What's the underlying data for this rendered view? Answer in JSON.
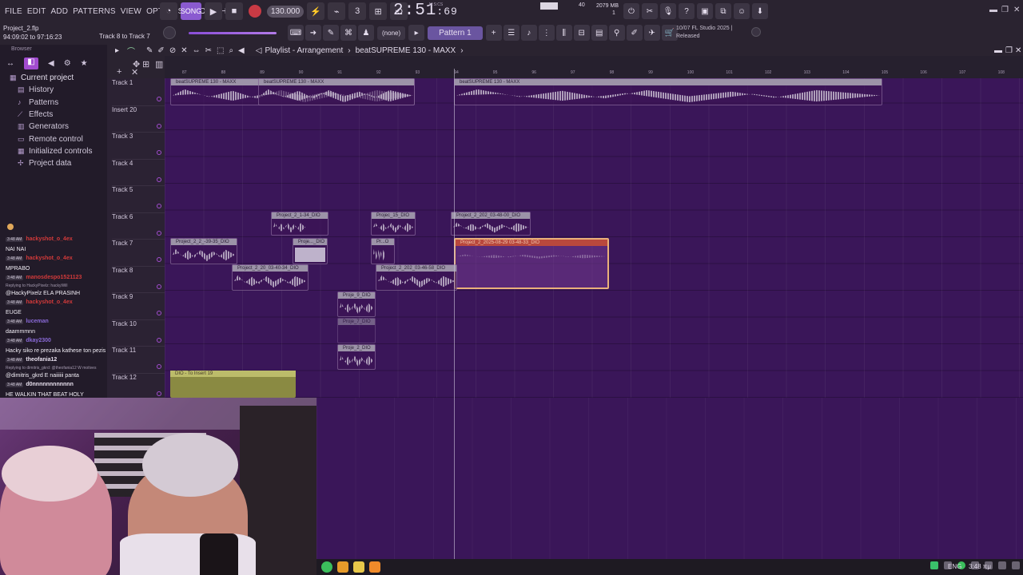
{
  "menu": [
    "FILE",
    "EDIT",
    "ADD",
    "PATTERNS",
    "VIEW",
    "OPTIONS",
    "TOOLS",
    "HELP"
  ],
  "transport": {
    "song_label": "SONG",
    "pat_label": "PAT",
    "bpm": "130.000"
  },
  "timecode": {
    "main": "2:51",
    "sub": ":69",
    "mscs": "M:S:CS"
  },
  "cpu": {
    "value": "40",
    "memory": "2079 MB",
    "voices": "1"
  },
  "project": {
    "file": "Project_2.flp",
    "time_range": "94:09:02 to 97:16:23",
    "hint": "Track 8 to Track 7"
  },
  "snap": "(none)",
  "pattern_selector": "Pattern 1",
  "version_info": {
    "date": "10/07",
    "name": "FL Studio 2025 |",
    "status": "Released"
  },
  "browser": {
    "header": "Browser",
    "items": [
      {
        "label": "Current project",
        "icon": "project-icon",
        "top": true
      },
      {
        "label": "History",
        "icon": "history-icon"
      },
      {
        "label": "Patterns",
        "icon": "patterns-icon"
      },
      {
        "label": "Effects",
        "icon": "effects-icon"
      },
      {
        "label": "Generators",
        "icon": "generators-icon"
      },
      {
        "label": "Remote control",
        "icon": "remote-icon"
      },
      {
        "label": "Initialized controls",
        "icon": "controls-icon"
      },
      {
        "label": "Project data",
        "icon": "data-icon"
      }
    ]
  },
  "playlist": {
    "breadcrumb_1": "Playlist - Arrangement",
    "breadcrumb_2": "beatSUPREME 130 - MAXX",
    "ruler": [
      "87",
      "88",
      "89",
      "90",
      "91",
      "92",
      "93",
      "94",
      "95",
      "96",
      "97",
      "98",
      "99",
      "100",
      "101",
      "102",
      "103",
      "104",
      "105",
      "106",
      "107",
      "108"
    ],
    "tracks": [
      "Track 1",
      "Insert 20",
      "Track 3",
      "Track 4",
      "Track 5",
      "Track 6",
      "Track 7",
      "Track 8",
      "Track 9",
      "Track 10",
      "Track 11",
      "Track 12"
    ]
  },
  "clips": [
    {
      "label": "beatSUPREME 130 - MAXX"
    },
    {
      "label": "beatSUPREME 130 - MAXX"
    },
    {
      "label": "beatSUPREME 130 - MAXX"
    },
    {
      "label": "Project_2_1-34_DIO"
    },
    {
      "label": "Projec_15_DIO"
    },
    {
      "label": "Project_2_202_03-48-00_DIO"
    },
    {
      "label": "Project_2_2_-39-35_DIO"
    },
    {
      "label": "Proje..._DIO"
    },
    {
      "label": "Pr...O"
    },
    {
      "label": "Project_2_2025-08-29 03-48-33_DIO"
    },
    {
      "label": "Project_2_20_03-40-34_DIO"
    },
    {
      "label": "Project_2_202_03-46-58_DIO"
    },
    {
      "label": "Proje_9_DIO"
    },
    {
      "label": "Proje_7_DIO"
    },
    {
      "label": "Proje_2_DIO"
    },
    {
      "label": "DIO - To Insert 19"
    }
  ],
  "chat": [
    {
      "time": "3:48 AM",
      "user": "hackyshot_o_4ex",
      "color": "#d23a3a"
    },
    {
      "msg": "NAI NAI"
    },
    {
      "time": "3:48 AM",
      "user": "hackyshot_o_4ex",
      "color": "#d23a3a"
    },
    {
      "msg": "MPRABO"
    },
    {
      "time": "3:48 AM",
      "user": "manosdespo1521123",
      "color": "#d23a3a"
    },
    {
      "reply": "Replying to HackyPixelz: hackyWill"
    },
    {
      "msg": "@HackyPixelz ELA PRASINH"
    },
    {
      "time": "3:48 AM",
      "user": "hackyshot_o_4ex",
      "color": "#d23a3a"
    },
    {
      "msg": "EUGE"
    },
    {
      "time": "3:48 AM",
      "user": "luceman",
      "color": "#8a6ad8"
    },
    {
      "msg": "daammmnn"
    },
    {
      "time": "3:48 AM",
      "user": "dkay2300",
      "color": "#8a6ad8"
    },
    {
      "msg": "Hacky siko re prezaka kathese ton pezis sto krevati"
    },
    {
      "time": "3:48 AM",
      "user": "theofania12",
      "color": "#e8e0ee"
    },
    {
      "reply": "Replying to dimitris_gkrd: @theofania12 W motives"
    },
    {
      "msg": "@dimitris_gkrd E naiiiiii panta"
    },
    {
      "time": "3:48 AM",
      "user": "d0nnnnnnnnnnnn",
      "color": "#e8e0ee"
    },
    {
      "msg": "HE WALKIN THAT BEAT HOLY"
    }
  ],
  "taskbar": {
    "lang": "ENG",
    "time": "3:48 πμ"
  }
}
